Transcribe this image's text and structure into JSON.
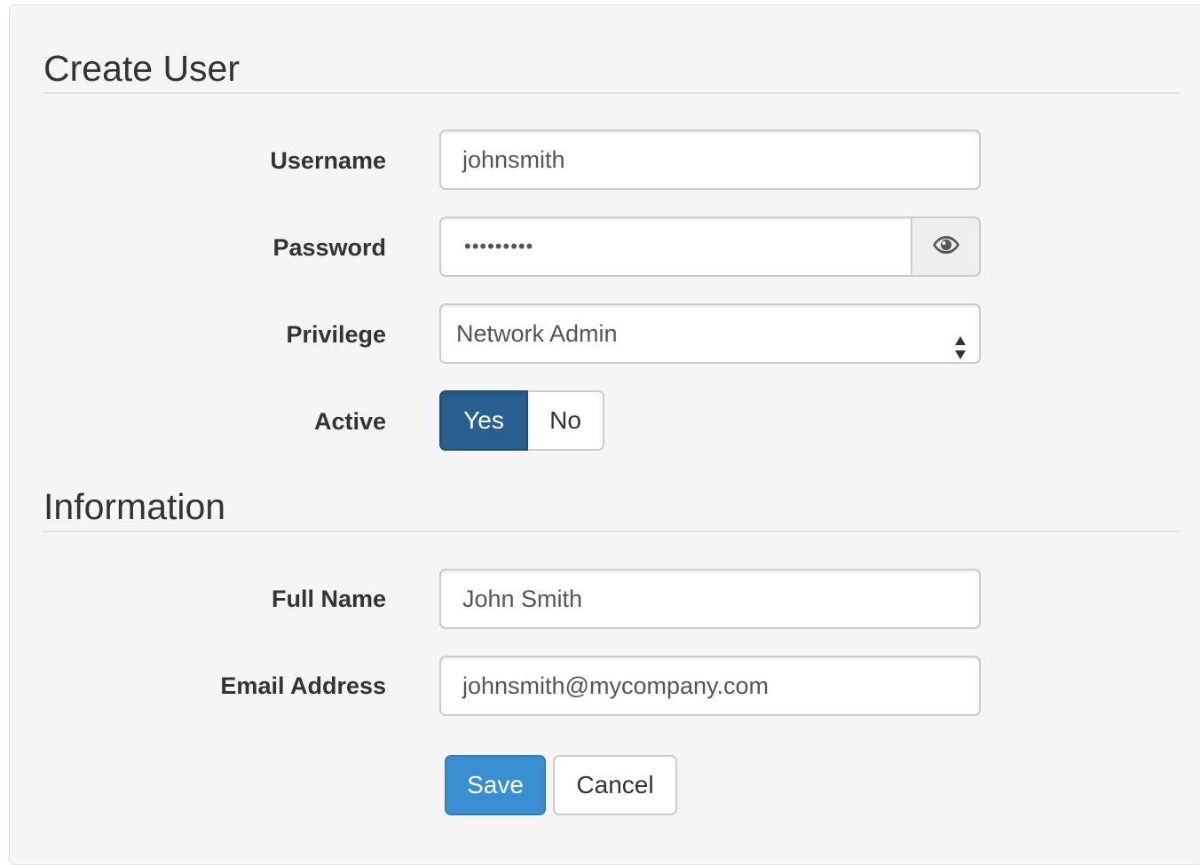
{
  "sections": {
    "create_user": {
      "title": "Create User"
    },
    "information": {
      "title": "Information"
    }
  },
  "fields": {
    "username": {
      "label": "Username",
      "value": "johnsmith"
    },
    "password": {
      "label": "Password",
      "value": "•••••••••",
      "toggle_icon": "eye-icon"
    },
    "privilege": {
      "label": "Privilege",
      "value": "Network Admin"
    },
    "active": {
      "label": "Active",
      "options": [
        "Yes",
        "No"
      ],
      "selected": "Yes"
    },
    "full_name": {
      "label": "Full Name",
      "value": "John Smith"
    },
    "email": {
      "label": "Email Address",
      "value": "johnsmith@mycompany.com"
    }
  },
  "actions": {
    "save_label": "Save",
    "cancel_label": "Cancel"
  },
  "colors": {
    "primary_active": "#286090",
    "primary": "#3a8fd3",
    "panel_bg": "#f5f5f5"
  }
}
